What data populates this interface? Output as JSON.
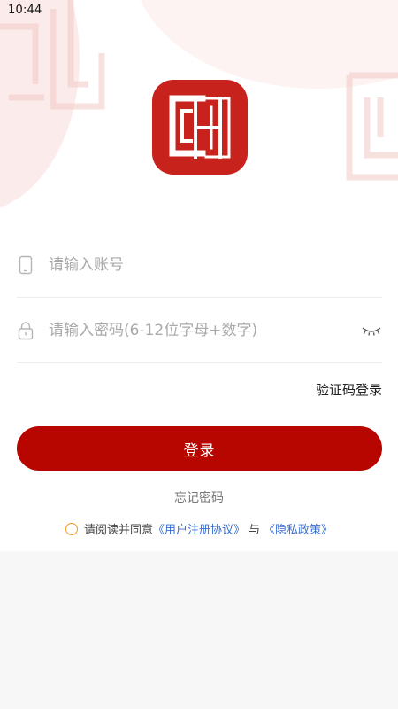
{
  "status_bar": {
    "time": "10:44"
  },
  "login_form": {
    "account": {
      "placeholder": "请输入账号",
      "value": ""
    },
    "password": {
      "placeholder": "请输入密码(6-12位字母+数字)",
      "value": ""
    },
    "sms_login_label": "验证码登录",
    "login_button_label": "登录",
    "forgot_password_label": "忘记密码"
  },
  "agreement": {
    "prefix": "请阅读并同意",
    "user_agreement_link": "《用户注册协议》",
    "connector": "与",
    "privacy_policy_link": "《隐私政策》",
    "checked": false
  },
  "icons": {
    "account": "phone-icon",
    "password": "lock-icon",
    "toggle": "eye-closed-icon",
    "logo": "app-logo-ch"
  },
  "colors": {
    "brand_red": "#c8221c",
    "button_red": "#b70500",
    "link_blue": "#3a6fd0",
    "radio_orange": "#f39a1b",
    "placeholder_gray": "#a9a9a9"
  }
}
